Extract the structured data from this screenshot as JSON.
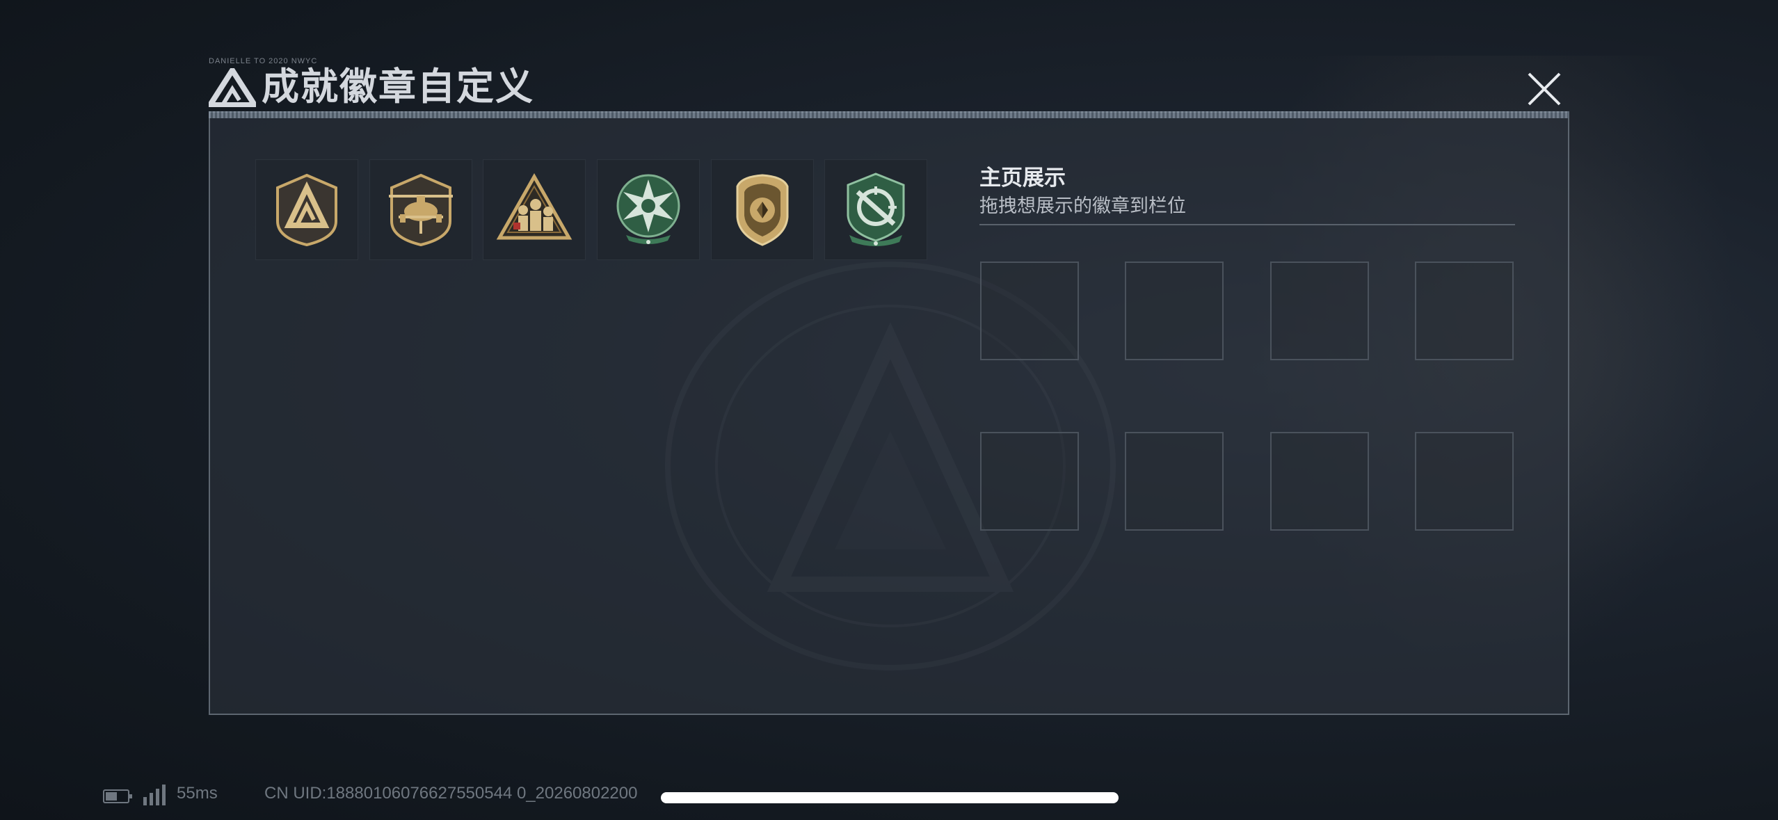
{
  "title": {
    "text": "成就徽章自定义",
    "micro_caption": "DANIELLE TO 2020 NWYC"
  },
  "badges": [
    {
      "icon": "delta-shield-badge-icon",
      "tone": "gold"
    },
    {
      "icon": "helicopter-badge-icon",
      "tone": "gold"
    },
    {
      "icon": "squad-triangle-badge-icon",
      "tone": "gold"
    },
    {
      "icon": "green-star-badge-icon",
      "tone": "green"
    },
    {
      "icon": "gold-crest-badge-icon",
      "tone": "gold"
    },
    {
      "icon": "crosshair-badge-icon",
      "tone": "green"
    }
  ],
  "showcase": {
    "title": "主页展示",
    "subtitle": "拖拽想展示的徽章到栏位",
    "slot_count": 8
  },
  "status_bar": {
    "latency": "55ms",
    "uid": "CN UID:18880106076627550544 0_20260802200"
  },
  "colors": {
    "gold": "#c8a86a",
    "green": "#3e7a58",
    "panel_border": "#5d6670",
    "slot_border": "#4a525c"
  }
}
